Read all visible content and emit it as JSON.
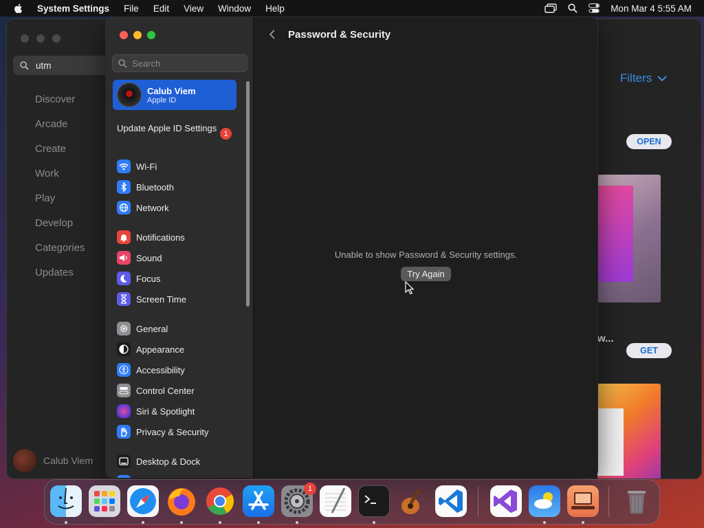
{
  "menubar": {
    "app_name": "System Settings",
    "menus": [
      "File",
      "Edit",
      "View",
      "Window",
      "Help"
    ],
    "datetime": "Mon Mar 4  5:55 AM"
  },
  "app_store": {
    "search_value": "utm",
    "nav": [
      "Discover",
      "Arcade",
      "Create",
      "Work",
      "Play",
      "Develop",
      "Categories",
      "Updates"
    ],
    "user_name": "Calub Viem",
    "filters_label": "Filters",
    "open_label": "OPEN",
    "get_label": "GET",
    "truncated_title": "w..."
  },
  "settings": {
    "search_placeholder": "Search",
    "apple_id": {
      "name": "Calub Viem",
      "subtitle": "Apple ID"
    },
    "update": {
      "label": "Update Apple ID Settings",
      "badge": "1"
    },
    "items": [
      {
        "label": "Wi-Fi",
        "icon": "wifi-icon",
        "color": "#2f7cf6"
      },
      {
        "label": "Bluetooth",
        "icon": "bluetooth-icon",
        "color": "#2f7cf6"
      },
      {
        "label": "Network",
        "icon": "globe-icon",
        "color": "#2f7cf6"
      },
      {
        "label": "Notifications",
        "icon": "bell-icon",
        "color": "#e8453c"
      },
      {
        "label": "Sound",
        "icon": "speaker-icon",
        "color": "#e84566"
      },
      {
        "label": "Focus",
        "icon": "moon-icon",
        "color": "#5e5ce6"
      },
      {
        "label": "Screen Time",
        "icon": "hourglass-icon",
        "color": "#5e5ce6"
      },
      {
        "label": "General",
        "icon": "gear-icon",
        "color": "#8e8e93"
      },
      {
        "label": "Appearance",
        "icon": "appearance-icon",
        "color": "#1c1c1e"
      },
      {
        "label": "Accessibility",
        "icon": "accessibility-icon",
        "color": "#2f7cf6"
      },
      {
        "label": "Control Center",
        "icon": "control-center-icon",
        "color": "#8e8e93"
      },
      {
        "label": "Siri & Spotlight",
        "icon": "siri-icon",
        "color": "#b04ad8"
      },
      {
        "label": "Privacy & Security",
        "icon": "hand-icon",
        "color": "#2f7cf6"
      },
      {
        "label": "Desktop & Dock",
        "icon": "desktop-icon",
        "color": "#1c1c1e"
      }
    ],
    "content": {
      "title": "Password & Security",
      "error_message": "Unable to show Password & Security settings.",
      "try_again_label": "Try Again"
    }
  },
  "dock": {
    "apps": [
      "Finder",
      "Launchpad",
      "Safari",
      "Firefox",
      "Chrome",
      "App Store",
      "System Settings",
      "TextEdit",
      "Terminal",
      "GarageBand",
      "Visual Studio Code",
      "Visual Studio",
      "Weather",
      "Remote Desktop",
      "Trash"
    ],
    "system_settings_badge": "1"
  }
}
